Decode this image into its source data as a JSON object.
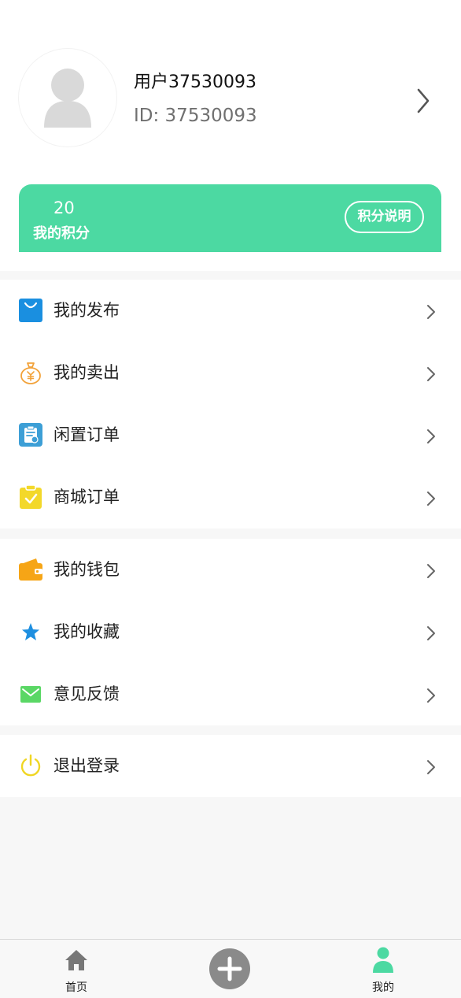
{
  "profile": {
    "username": "用户37530093",
    "id_text": "ID: 37530093"
  },
  "points": {
    "value": "20",
    "label": "我的积分",
    "button_label": "积分说明"
  },
  "menu_group_1": [
    {
      "label": "我的发布",
      "icon": "shopping-bag-icon",
      "color": "#1a8fe0"
    },
    {
      "label": "我的卖出",
      "icon": "money-bag-icon",
      "color": "#f2a23a"
    },
    {
      "label": "闲置订单",
      "icon": "clipboard-icon",
      "color": "#3d9fd6"
    },
    {
      "label": "商城订单",
      "icon": "checklist-icon",
      "color": "#f3d82a"
    }
  ],
  "menu_group_2": [
    {
      "label": "我的钱包",
      "icon": "wallet-icon",
      "color": "#f6a516"
    },
    {
      "label": "我的收藏",
      "icon": "star-icon",
      "color": "#1e8fe0"
    },
    {
      "label": "意见反馈",
      "icon": "envelope-icon",
      "color": "#5ad765"
    }
  ],
  "menu_group_3": [
    {
      "label": "退出登录",
      "icon": "power-icon",
      "color": "#f0d624"
    }
  ],
  "tabbar": {
    "home_label": "首页",
    "me_label": "我的",
    "active_color": "#4cd9a2"
  }
}
